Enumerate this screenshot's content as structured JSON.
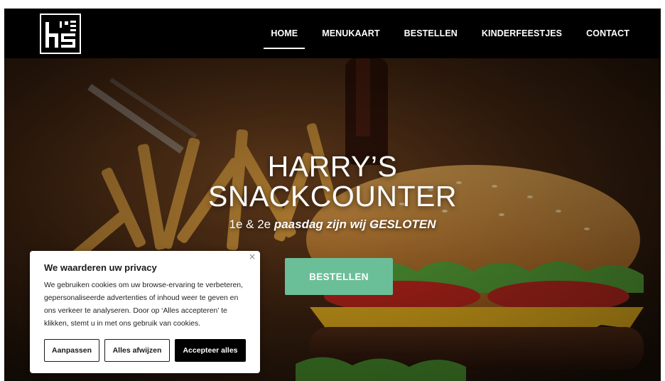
{
  "nav": {
    "items": [
      {
        "label": "HOME",
        "active": true
      },
      {
        "label": "MENUKAART",
        "active": false
      },
      {
        "label": "BESTELLEN",
        "active": false
      },
      {
        "label": "KINDERFEESTJES",
        "active": false
      },
      {
        "label": "CONTACT",
        "active": false
      }
    ]
  },
  "hero": {
    "title_line1": "HARRY’S",
    "title_line2": "SNACKCOUNTER",
    "subtitle_prefix": "1e & 2e",
    "subtitle_rest": " paasdag zijn wij GESLOTEN",
    "button_label": "BESTELLEN",
    "button_color": "#6bbf98"
  },
  "cookie": {
    "close_symbol": "×",
    "title": "We waarderen uw privacy",
    "text": "We gebruiken cookies om uw browse-ervaring te verbeteren, gepersonaliseerde advertenties of inhoud weer te geven en ons verkeer te analyseren. Door op ‘Alles accepteren’ te klikken, stemt u in met ons gebruik van cookies.",
    "customize_label": "Aanpassen",
    "reject_label": "Alles afwijzen",
    "accept_label": "Accepteer alles"
  },
  "colors": {
    "header_bg": "#000000",
    "accent_green": "#6bbf98",
    "text_white": "#ffffff"
  }
}
